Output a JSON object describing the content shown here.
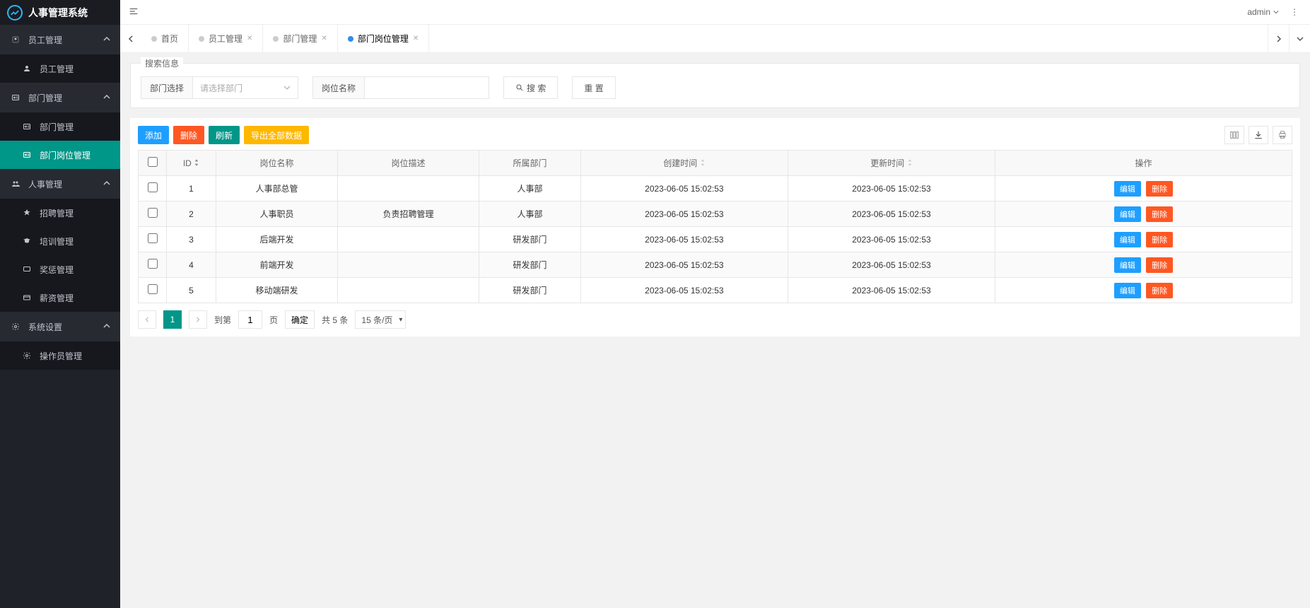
{
  "app_title": "人事管理系统",
  "user_name": "admin",
  "sidebar": {
    "groups": [
      {
        "label": "员工管理",
        "icon": "users",
        "items": [
          {
            "label": "员工管理",
            "icon": "user"
          }
        ]
      },
      {
        "label": "部门管理",
        "icon": "id",
        "items": [
          {
            "label": "部门管理",
            "icon": "id"
          },
          {
            "label": "部门岗位管理",
            "icon": "id",
            "active": true
          }
        ]
      },
      {
        "label": "人事管理",
        "icon": "group",
        "items": [
          {
            "label": "招聘管理",
            "icon": "hire"
          },
          {
            "label": "培训管理",
            "icon": "train"
          },
          {
            "label": "奖惩管理",
            "icon": "award"
          },
          {
            "label": "薪资管理",
            "icon": "salary"
          }
        ]
      },
      {
        "label": "系统设置",
        "icon": "gear",
        "items": [
          {
            "label": "操作员管理",
            "icon": "gear"
          }
        ]
      }
    ]
  },
  "tabs": [
    {
      "label": "首页",
      "closable": false
    },
    {
      "label": "员工管理",
      "closable": true
    },
    {
      "label": "部门管理",
      "closable": true
    },
    {
      "label": "部门岗位管理",
      "closable": true,
      "active": true
    }
  ],
  "search": {
    "legend": "搜索信息",
    "dept_label": "部门选择",
    "dept_placeholder": "请选择部门",
    "post_label": "岗位名称",
    "search_btn": "搜 索",
    "reset_btn": "重 置"
  },
  "toolbar": {
    "add": "添加",
    "delete": "删除",
    "refresh": "刷新",
    "export": "导出全部数据"
  },
  "table": {
    "headers": [
      "",
      "ID",
      "岗位名称",
      "岗位描述",
      "所属部门",
      "创建时间",
      "更新时间",
      "操作"
    ],
    "rows": [
      {
        "id": "1",
        "name": "人事部总管",
        "desc": "",
        "dept": "人事部",
        "created": "2023-06-05 15:02:53",
        "updated": "2023-06-05 15:02:53"
      },
      {
        "id": "2",
        "name": "人事职员",
        "desc": "负责招聘管理",
        "dept": "人事部",
        "created": "2023-06-05 15:02:53",
        "updated": "2023-06-05 15:02:53"
      },
      {
        "id": "3",
        "name": "后端开发",
        "desc": "",
        "dept": "研发部门",
        "created": "2023-06-05 15:02:53",
        "updated": "2023-06-05 15:02:53"
      },
      {
        "id": "4",
        "name": "前端开发",
        "desc": "",
        "dept": "研发部门",
        "created": "2023-06-05 15:02:53",
        "updated": "2023-06-05 15:02:53"
      },
      {
        "id": "5",
        "name": "移动端研发",
        "desc": "",
        "dept": "研发部门",
        "created": "2023-06-05 15:02:53",
        "updated": "2023-06-05 15:02:53"
      }
    ],
    "edit_btn": "编辑",
    "delete_btn": "删除"
  },
  "pagination": {
    "current": "1",
    "to_label": "到第",
    "page_input": "1",
    "page_suffix": "页",
    "confirm": "确定",
    "total_label": "共 5 条",
    "page_size": "15 条/页"
  }
}
